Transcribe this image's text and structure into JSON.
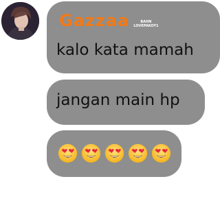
{
  "chat": {
    "sender_name": "Gazzaa",
    "sender_badge": [
      "BAHN",
      "LOVEPAKOY1"
    ],
    "messages": [
      {
        "text": "kalo kata mamah"
      },
      {
        "text": "jangan main hp"
      },
      {
        "emojis": [
          "heart-eyes-emoji",
          "heart-eyes-emoji",
          "heart-eyes-emoji",
          "heart-eyes-emoji",
          "heart-eyes-emoji"
        ]
      }
    ]
  },
  "colors": {
    "bubble": "#8e8e8e",
    "sender_name": "#ef7a1a",
    "background": "#ffffff"
  }
}
